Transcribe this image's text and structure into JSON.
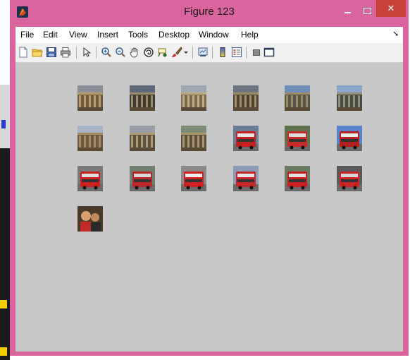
{
  "window": {
    "title": "Figure 123",
    "close_glyph": "✕"
  },
  "menu": {
    "items": [
      "File",
      "Edit",
      "View",
      "Insert",
      "Tools",
      "Desktop",
      "Window",
      "Help"
    ],
    "overflow_glyph": "➘"
  },
  "toolbar": {
    "icons": [
      "new-figure-icon",
      "open-file-icon",
      "save-icon",
      "print-icon",
      "edit-plot-arrow-icon",
      "zoom-in-icon",
      "zoom-out-icon",
      "pan-hand-icon",
      "rotate-3d-icon",
      "data-cursor-icon",
      "brush-icon",
      "brush-dropdown-icon",
      "link-plot-icon",
      "colorbar-icon",
      "legend-icon",
      "hide-plot-tools-icon",
      "show-plot-tools-icon"
    ]
  },
  "thumbnails": [
    {
      "subject": "colosseum",
      "colors": [
        "#8a8f96",
        "#6e5a3c",
        "#b79c6e"
      ]
    },
    {
      "subject": "colosseum",
      "colors": [
        "#5f6a78",
        "#3f3a30",
        "#9b8b6a"
      ]
    },
    {
      "subject": "colosseum",
      "colors": [
        "#9fa7b0",
        "#7a6a4e",
        "#c2ab80"
      ]
    },
    {
      "subject": "colosseum",
      "colors": [
        "#6c7480",
        "#4d4436",
        "#a38e6a"
      ]
    },
    {
      "subject": "colosseum",
      "colors": [
        "#6f8fb8",
        "#58564a",
        "#9b8b66"
      ]
    },
    {
      "subject": "ruins",
      "colors": [
        "#8aa6c8",
        "#4a4a44",
        "#8e8e7a"
      ]
    },
    {
      "subject": "temple",
      "colors": [
        "#a6b4c6",
        "#6b5a44",
        "#a58a62"
      ]
    },
    {
      "subject": "temple",
      "colors": [
        "#9a9ea6",
        "#5a5142",
        "#b09a72"
      ]
    },
    {
      "subject": "temple",
      "colors": [
        "#7e8c74",
        "#5b4e3a",
        "#a8956e"
      ]
    },
    {
      "subject": "red-bus",
      "colors": [
        "#6a7d96",
        "#c8201e",
        "#e6e6e6"
      ]
    },
    {
      "subject": "red-bus",
      "colors": [
        "#5e7250",
        "#c92a2a",
        "#dcdcdc"
      ]
    },
    {
      "subject": "red-bus",
      "colors": [
        "#5b84c8",
        "#b82020",
        "#ececec"
      ]
    },
    {
      "subject": "red-bus",
      "colors": [
        "#7a7a7a",
        "#cc2222",
        "#e0e0e0"
      ]
    },
    {
      "subject": "red-bus",
      "colors": [
        "#6f7f70",
        "#b82828",
        "#d8d8d8"
      ]
    },
    {
      "subject": "red-bus",
      "colors": [
        "#8a8a8a",
        "#d02020",
        "#f0f0f0"
      ]
    },
    {
      "subject": "red-bus",
      "colors": [
        "#8b9db6",
        "#c62626",
        "#e8e8e8"
      ]
    },
    {
      "subject": "red-bus",
      "colors": [
        "#6b7b62",
        "#c82020",
        "#e2e2e2"
      ]
    },
    {
      "subject": "red-bus",
      "colors": [
        "#5a5a5a",
        "#cc2424",
        "#d6d6d6"
      ]
    },
    {
      "subject": "person",
      "colors": [
        "#4a3a2a",
        "#c22a2a",
        "#d8a070"
      ]
    }
  ]
}
